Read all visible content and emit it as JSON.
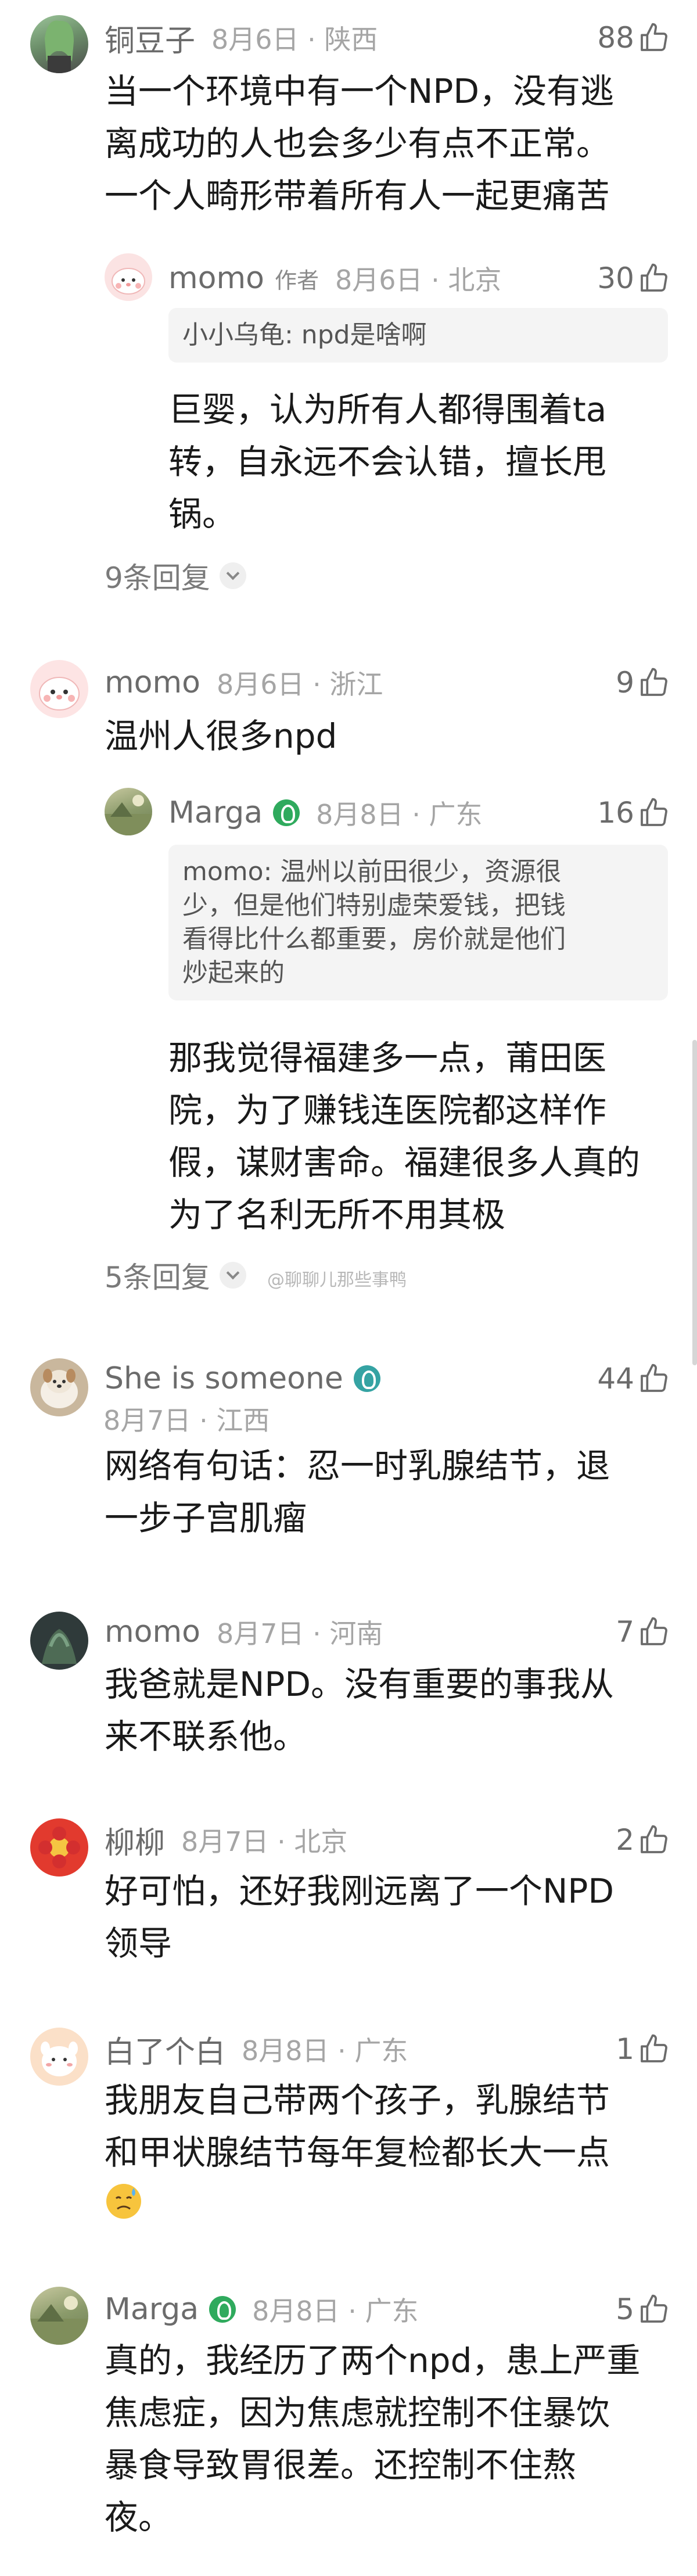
{
  "comments": [
    {
      "name": "铜豆子",
      "time": "8月6日 · 陕西",
      "likes": "88",
      "text": "当一个环境中有一个NPD，没有逃\n离成功的人也会多少有点不正常。\n一个人畸形带着所有人一起更痛苦",
      "reply": {
        "name": "momo",
        "author_tag": "作者",
        "time": "8月6日 · 北京",
        "likes": "30",
        "quote": "小小乌龟: npd是啥啊",
        "text": "巨婴，认为所有人都得围着ta\n转，自永远不会认错，擅长甩\n锅。"
      },
      "more": "9条回复"
    },
    {
      "name": "momo",
      "time": "8月6日 · 浙江",
      "likes": "9",
      "text": "温州人很多npd",
      "reply": {
        "name": "Marga",
        "time": "8月8日 · 广东",
        "likes": "16",
        "quote": "momo: 温州以前田很少，资源很\n少，但是他们特别虚荣爱钱，把钱\n看得比什么都重要，房价就是他们\n炒起来的",
        "text": "那我觉得福建多一点，莆田医\n院，为了赚钱连医院都这样作\n假，谋财害命。福建很多人真的\n为了名利无所不用其极"
      },
      "more": "5条回复",
      "watermark": "@聊聊儿那些事鸭"
    },
    {
      "name": "She is someone",
      "time": "8月7日 · 江西",
      "likes": "44",
      "text": "网络有句话：忍一时乳腺结节，退\n一步子宫肌瘤"
    },
    {
      "name": "momo",
      "time": "8月7日 · 河南",
      "likes": "7",
      "text": "我爸就是NPD。没有重要的事我从\n来不联系他。"
    },
    {
      "name": "柳柳",
      "time": "8月7日 · 北京",
      "likes": "2",
      "text": "好可怕，还好我刚远离了一个NPD\n领导"
    },
    {
      "name": "白了个白",
      "time": "8月8日 · 广东",
      "likes": "1",
      "text": "我朋友自己带两个孩子，乳腺结节\n和甲状腺结节每年复检都长大一点",
      "emoji": "sweat-face"
    },
    {
      "name": "Marga",
      "time": "8月8日 · 广东",
      "likes": "5",
      "text": "真的，我经历了两个npd，患上严重\n焦虑症，因为焦虑就控制不住暴饮\n暴食导致胃很差。还控制不住熬\n夜。"
    }
  ],
  "icons": {
    "like": "thumbs-up-icon",
    "expand": "chevron-down-icon",
    "badge": "vip-badge-icon"
  },
  "colors": {
    "name": "#6b6b6b",
    "meta": "#a5a5a5",
    "text": "#1a1a1a",
    "quote_bg": "#f4f4f4",
    "badge_green": "#2faa5d",
    "badge_teal": "#35a3a3"
  }
}
